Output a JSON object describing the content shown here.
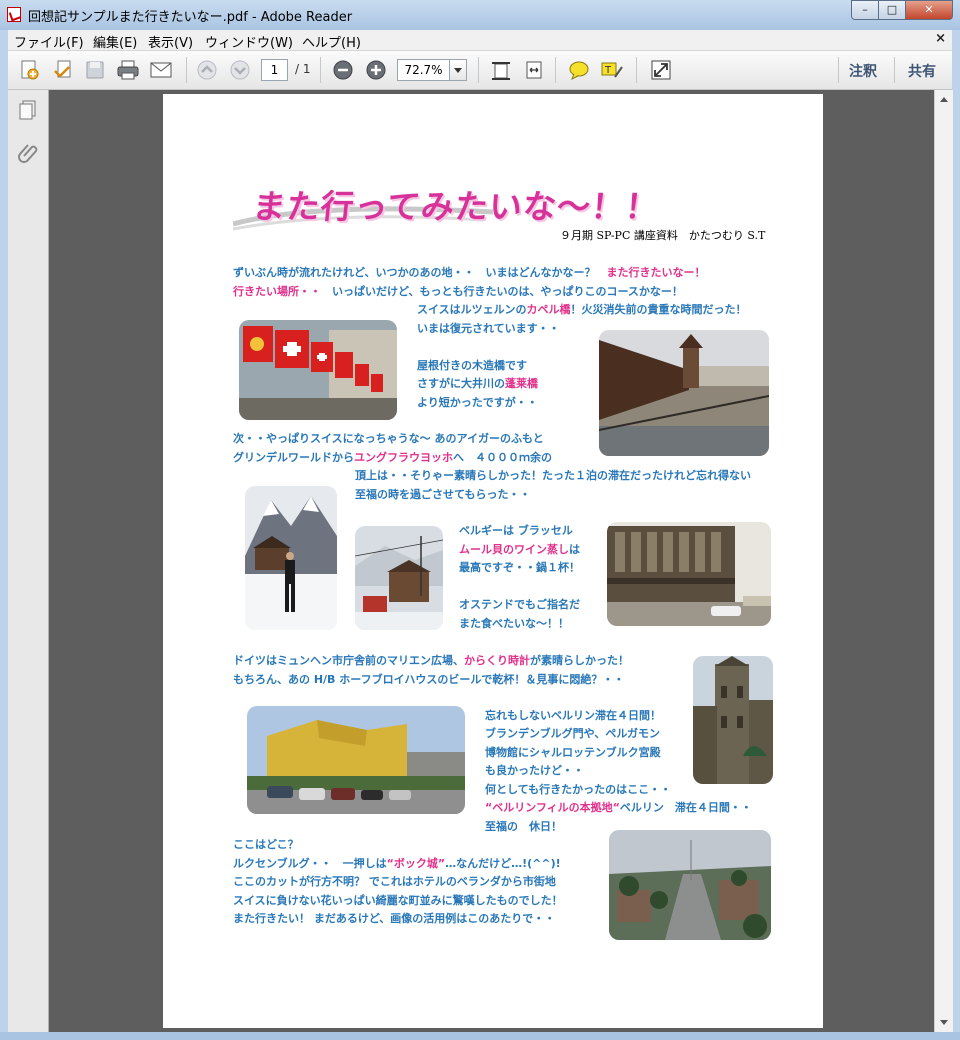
{
  "window": {
    "title": "回想記サンプルまた行きたいなー.pdf - Adobe Reader",
    "controls": {
      "min": "–",
      "max": "□",
      "close": "✕"
    }
  },
  "menu": {
    "items": [
      "ファイル(F)",
      "編集(E)",
      "表示(V)",
      "ウィンドウ(W)",
      "ヘルプ(H)"
    ],
    "close": "×"
  },
  "toolbar": {
    "page_current": "1",
    "page_total": "/ 1",
    "zoom": "72.7%",
    "comment_label": "注釈",
    "share_label": "共有"
  },
  "document": {
    "headline": "また行ってみたいな～！！",
    "subheading": "９月期 SP-PC 講座資料　かたつむり S.T",
    "paragraphs": [
      {
        "parts": [
          {
            "text": "ずいぶん時が流れたけれど、いつかのあの地・・　いまはどんなかなー？　"
          },
          {
            "text": "また行きたいなー！",
            "pink": true
          }
        ]
      },
      {
        "parts": [
          {
            "text": "行きたい場所・・",
            "pink": true
          },
          {
            "text": "　いっぱいだけど、もっとも行きたいのは、やっぱりこのコースかなー！"
          }
        ]
      },
      {
        "parts": [
          {
            "text": "スイスはルツェルンの"
          },
          {
            "text": "カペル橋",
            "pink": true
          },
          {
            "text": "！火災消失前の貴重な時間だった！"
          }
        ]
      },
      {
        "parts": [
          {
            "text": "いまは復元されています・・"
          }
        ]
      },
      {
        "parts": [
          {
            "text": "屋根付きの木造橋です"
          }
        ]
      },
      {
        "parts": [
          {
            "text": "さすがに大井川の"
          },
          {
            "text": "蓬莱橋",
            "pink": true
          }
        ]
      },
      {
        "parts": [
          {
            "text": "より短かったですが・・"
          }
        ]
      },
      {
        "parts": [
          {
            "text": "次・・やっぱりスイスになっちゃうな～ あのアイガーのふもと"
          }
        ]
      },
      {
        "parts": [
          {
            "text": "グリンデルワールドから"
          },
          {
            "text": "ユングフラウヨッホ",
            "pink": true
          },
          {
            "text": "へ　４０００ｍ余の"
          }
        ]
      },
      {
        "parts": [
          {
            "text": "頂上は・・そりゃー素晴らしかった！たった１泊の滞在だったけれど忘れ得ない"
          }
        ]
      },
      {
        "parts": [
          {
            "text": "至福の時を過ごさせてもらった・・"
          }
        ]
      },
      {
        "parts": [
          {
            "text": "ベルギーは ブラッセル"
          }
        ]
      },
      {
        "parts": [
          {
            "text": "ムール貝のワイン蒸し",
            "pink": true
          },
          {
            "text": "は"
          }
        ]
      },
      {
        "parts": [
          {
            "text": "最高ですぞ・・鍋１杯！"
          }
        ]
      },
      {
        "parts": [
          {
            "text": "オステンドでもご指名だ"
          }
        ]
      },
      {
        "parts": [
          {
            "text": "また食べたいな～！！"
          }
        ]
      },
      {
        "parts": [
          {
            "text": "ドイツはミュンヘン市庁舎前のマリエン広場、"
          },
          {
            "text": "からくり時計",
            "pink": true
          },
          {
            "text": "が素晴らしかった！"
          }
        ]
      },
      {
        "parts": [
          {
            "text": "もちろん、あの H/B ホーフブロイハウスのビールで乾杯！＆見事に悶絶？・・"
          }
        ]
      },
      {
        "parts": [
          {
            "text": "忘れもしないベルリン滞在４日間！"
          }
        ]
      },
      {
        "parts": [
          {
            "text": "ブランデンブルグ門や、ペルガモン"
          }
        ]
      },
      {
        "parts": [
          {
            "text": "博物館にシャルロッテンブルク宮殿"
          }
        ]
      },
      {
        "parts": [
          {
            "text": "も良かったけど・・"
          }
        ]
      },
      {
        "parts": [
          {
            "text": "何としても行きたかったのはここ・・"
          }
        ]
      },
      {
        "parts": [
          {
            "text": "“ベルリンフィルの本拠地“",
            "pink": true
          },
          {
            "text": "ベルリン　滞在４日間・・"
          }
        ]
      },
      {
        "parts": [
          {
            "text": "至福の　休日！"
          }
        ]
      },
      {
        "parts": [
          {
            "text": "ここはどこ？"
          }
        ]
      },
      {
        "parts": [
          {
            "text": "ルクセンブルグ・・　一押しは"
          },
          {
            "text": "“ボック城”",
            "pink": true
          },
          {
            "text": "…なんだけど…!(^^)!"
          }
        ]
      },
      {
        "parts": [
          {
            "text": "ここのカットが行方不明？ でこれはホテルのベランダから市街地"
          }
        ]
      },
      {
        "parts": [
          {
            "text": "スイスに負けない花いっぱい綺麗な町並みに驚嘆したものでした！"
          }
        ]
      },
      {
        "parts": [
          {
            "text": "また行きたい！ まだあるけど、画像の活用例はこのあたりで・・"
          }
        ]
      }
    ]
  },
  "colors": {
    "text_blue": "#2a78b8",
    "text_pink": "#e0328c",
    "headline": "#d6329a"
  }
}
